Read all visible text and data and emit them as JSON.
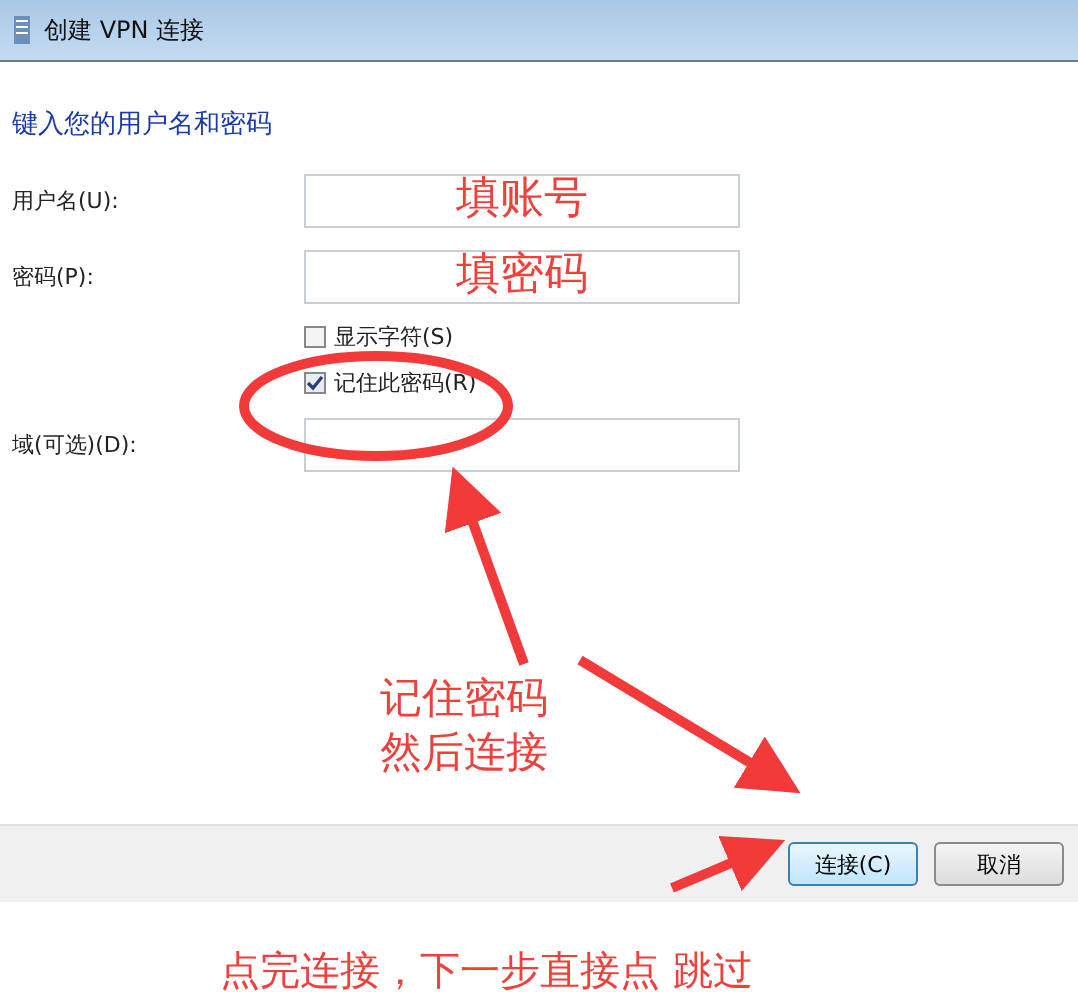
{
  "window": {
    "title": "创建 VPN 连接"
  },
  "heading": "键入您的用户名和密码",
  "fields": [
    {
      "label": "用户名(U):",
      "value": "填账号"
    },
    {
      "label": "密码(P):",
      "value": "填密码"
    }
  ],
  "checkboxes": [
    {
      "label": "显示字符(S)",
      "checked": false
    },
    {
      "label": "记住此密码(R)",
      "checked": true
    }
  ],
  "domain": {
    "label": "域(可选)(D):"
  },
  "buttons": [
    {
      "label": "连接(C)",
      "selected": true
    },
    {
      "label": "取消",
      "selected": false
    }
  ],
  "annotations": {
    "note": [
      "记住密码",
      "然后连接"
    ],
    "footer": "点完连接，下一步直接点 跳过"
  }
}
